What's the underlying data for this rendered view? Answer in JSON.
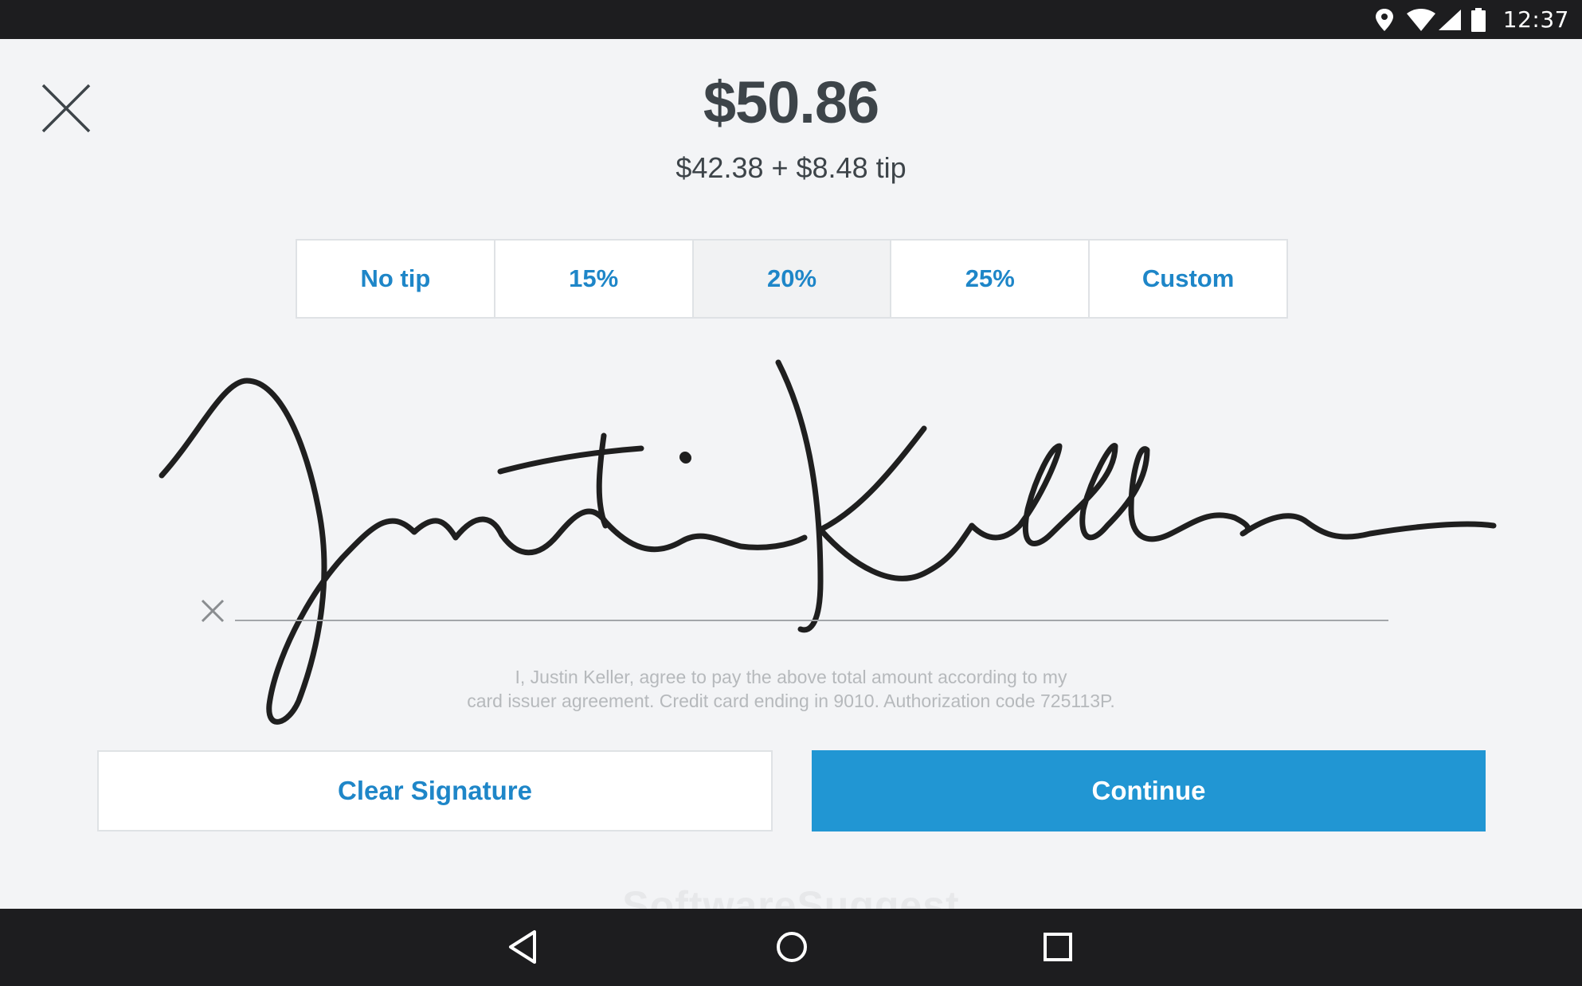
{
  "status_bar": {
    "time": "12:37",
    "icons": [
      "location-icon",
      "wifi-icon",
      "cell-signal-icon",
      "battery-icon"
    ]
  },
  "header": {
    "close_icon": "close-icon",
    "total": "$50.86",
    "breakdown": "$42.38 + $8.48 tip"
  },
  "tip_options": {
    "items": [
      {
        "label": "No tip",
        "selected": false
      },
      {
        "label": "15%",
        "selected": false
      },
      {
        "label": "20%",
        "selected": true
      },
      {
        "label": "25%",
        "selected": false
      },
      {
        "label": "Custom",
        "selected": false
      }
    ]
  },
  "signature": {
    "signer_name": "Justin Keller",
    "x_mark_icon": "x-mark-icon",
    "agreement_line1": "I, Justin Keller, agree to pay the above total amount according to my",
    "agreement_line2": "card issuer agreement. Credit card ending in 9010. Authorization code 725113P."
  },
  "actions": {
    "clear_label": "Clear Signature",
    "continue_label": "Continue"
  },
  "watermark": "SoftwareSuggest",
  "nav_bar": {
    "icons": [
      "back-icon",
      "home-icon",
      "recents-icon"
    ]
  },
  "colors": {
    "accent": "#1e86c8",
    "continue_bg": "#2196d3",
    "background": "#f3f4f6",
    "system_bar": "#1d1d1f",
    "text_dark": "#3d4449"
  }
}
